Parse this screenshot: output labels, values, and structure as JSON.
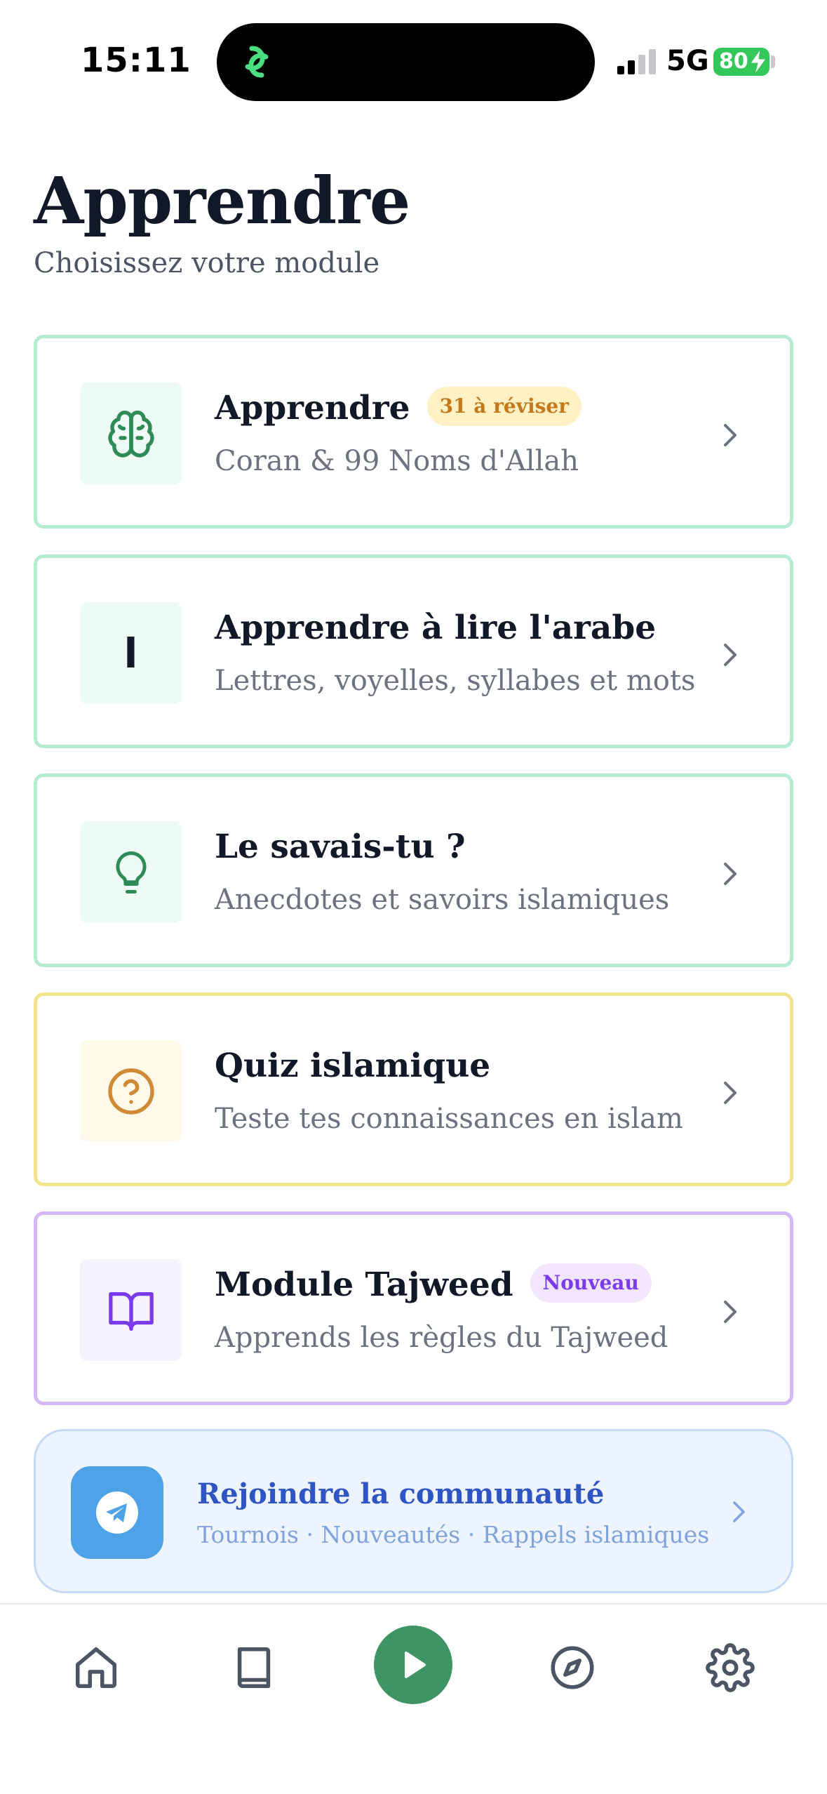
{
  "status_bar": {
    "time": "15:11",
    "network": "5G",
    "battery": "80"
  },
  "header": {
    "title": "Apprendre",
    "subtitle": "Choisissez votre module"
  },
  "cards": [
    {
      "title": "Apprendre",
      "badge": "31 à réviser",
      "subtitle": "Coran & 99 Noms d'Allah",
      "icon": "brain-icon",
      "accent": "#2e8b57"
    },
    {
      "title": "Apprendre à lire l'arabe",
      "subtitle": "Lettres, voyelles, syllabes et mots",
      "icon_glyph": "ا",
      "icon": "alif-letter-icon"
    },
    {
      "title": "Le savais-tu ?",
      "subtitle": "Anecdotes et savoirs islamiques",
      "icon": "lightbulb-icon",
      "accent": "#2e8b57"
    },
    {
      "title": "Quiz islamique",
      "subtitle": "Teste tes connaissances en islam",
      "icon": "question-circle-icon",
      "accent": "#d08a35"
    },
    {
      "title": "Module Tajweed",
      "badge": "Nouveau",
      "subtitle": "Apprends les règles du Tajweed",
      "icon": "open-book-icon",
      "accent": "#7c3aed"
    }
  ],
  "community": {
    "title": "Rejoindre la communauté",
    "subtitle": "Tournois · Nouveautés · Rappels islamiques",
    "icon": "telegram-icon",
    "accent": "#4ea3e8"
  },
  "nav": {
    "items": [
      "home-icon",
      "book-icon",
      "play-icon",
      "compass-icon",
      "gear-icon"
    ],
    "active_color": "#3f9463"
  }
}
